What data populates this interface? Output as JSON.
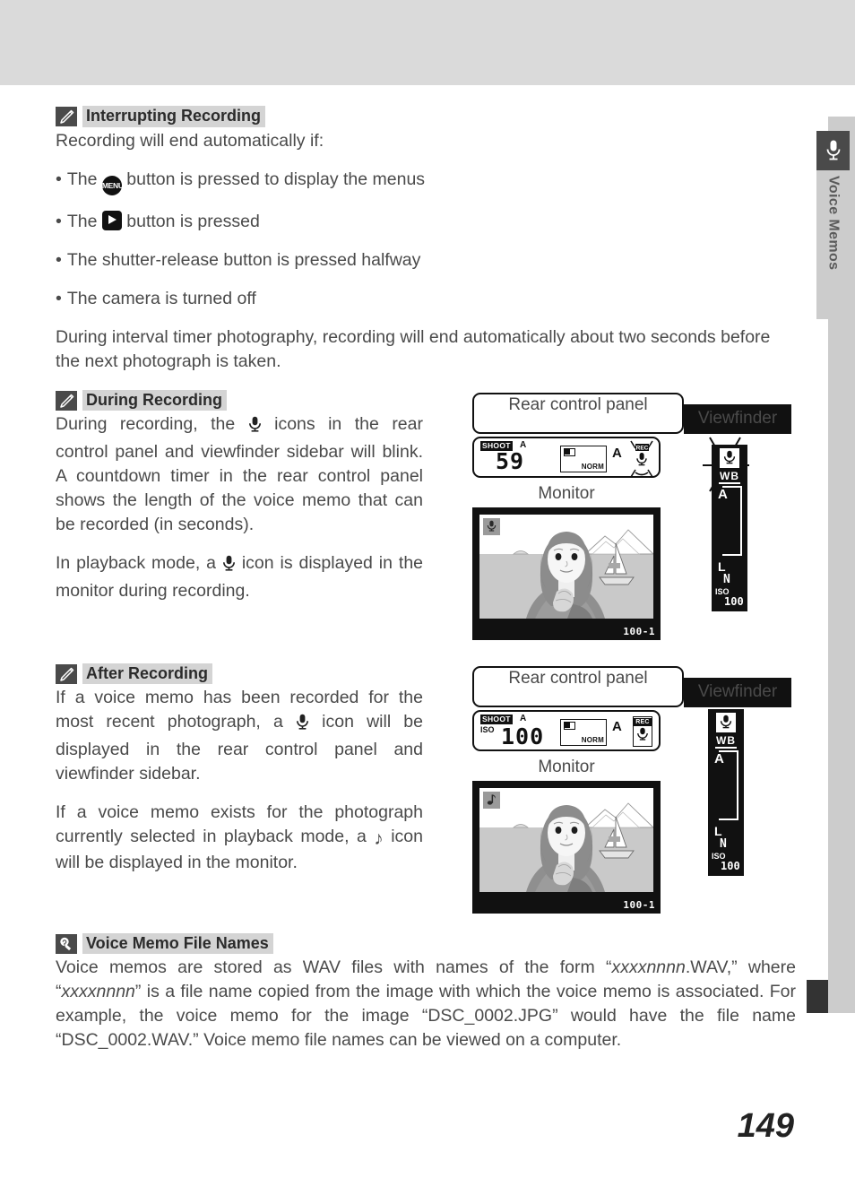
{
  "sidebar": {
    "icon": "microphone-icon",
    "label": "Voice Memos"
  },
  "page_number": "149",
  "sections": [
    {
      "id": "interrupting-recording",
      "icon": "pencil-icon",
      "title": "Interrupting Recording",
      "intro": "Recording will end automatically if:",
      "bullets": [
        {
          "before": "The ",
          "icon": "menu-button-icon",
          "after": " button is pressed to display the menus"
        },
        {
          "before": "The ",
          "icon": "playback-button-icon",
          "after": " button is pressed"
        },
        {
          "before": "The shutter-release button is pressed halfway",
          "icon": "",
          "after": ""
        },
        {
          "before": "The camera is turned off",
          "icon": "",
          "after": ""
        }
      ],
      "outro": "During interval timer photography, recording will end automatically about two seconds before the next photograph is taken."
    },
    {
      "id": "during-recording",
      "icon": "pencil-icon",
      "title": "During Recording",
      "paragraph_1_a": "During recording, the ",
      "paragraph_1_icon": "microphone-icon",
      "paragraph_1_b": " icons in the rear control panel and viewfinder sidebar will blink.  A countdown timer in the rear control panel shows the length of the voice memo that can be recorded (in seconds).",
      "paragraph_2_a": "In playback mode, a ",
      "paragraph_2_icon": "microphone-icon",
      "paragraph_2_b": " icon is displayed in the monitor during recording."
    },
    {
      "id": "after-recording",
      "icon": "pencil-icon",
      "title": "After Recording",
      "paragraph_1_a": "If a voice memo has been recorded for the most recent photograph, a ",
      "paragraph_1_icon": "microphone-icon",
      "paragraph_1_b": " icon will be displayed in the rear control panel and viewfinder sidebar.",
      "paragraph_2_a": "If a voice memo exists for the photograph currently selected in playback mode, a ",
      "paragraph_2_icon": "music-note-icon",
      "paragraph_2_b": " icon will be displayed in the monitor."
    },
    {
      "id": "voice-memo-file-names",
      "icon": "magnifier-icon",
      "title": "Voice Memo File Names",
      "body_1": "Voice memos are stored as WAV files with names of the form “",
      "body_italic_1": "xxxxnnnn",
      "body_2": ".WAV,” where “",
      "body_italic_2": "xxxxnnnn",
      "body_3": "” is a file name copied from the image with which the voice memo is associated.  For example, the voice memo for the image “DSC_0002.JPG” would have the file name “DSC_0002.WAV.”  Voice memo file names can be viewed on a computer."
    }
  ],
  "figures": [
    {
      "id": "during-recording-figure",
      "label_rear_panel": "Rear control panel",
      "label_viewfinder": "Viewfinder",
      "label_monitor": "Monitor",
      "rear_panel": {
        "shoot_label": "SHOOT",
        "a_flag": "A",
        "iso_label": "",
        "big_number": "59",
        "quality_box_label": "NORM",
        "exposure_mode": "A",
        "rec_label": "REC",
        "rec_blinking": true
      },
      "viewfinder": {
        "mic_icon": "microphone-icon",
        "mic_blinking": true,
        "wb_label": "WB",
        "wb_value": "A",
        "image_size": "L",
        "image_quality": "N",
        "iso_label": "ISO",
        "iso_value": "100"
      },
      "monitor": {
        "badge_icon": "microphone-icon",
        "frame_number": "100-1"
      }
    },
    {
      "id": "after-recording-figure",
      "label_rear_panel": "Rear control panel",
      "label_viewfinder": "Viewfinder",
      "label_monitor": "Monitor",
      "rear_panel": {
        "shoot_label": "SHOOT",
        "a_flag": "A",
        "iso_label": "ISO",
        "big_number": "100",
        "quality_box_label": "NORM",
        "exposure_mode": "A",
        "rec_label": "REC",
        "rec_blinking": false
      },
      "viewfinder": {
        "mic_icon": "microphone-icon",
        "mic_blinking": false,
        "wb_label": "WB",
        "wb_value": "A",
        "image_size": "L",
        "image_quality": "N",
        "iso_label": "ISO",
        "iso_value": "100"
      },
      "monitor": {
        "badge_icon": "music-note-icon",
        "frame_number": "100-1"
      }
    }
  ],
  "colors": {
    "top_band": "#dadada",
    "rail": "#cccccc",
    "heading_highlight": "#d4d4d4",
    "icon_box": "#4a4a4a",
    "text": "#4a4a4a"
  }
}
